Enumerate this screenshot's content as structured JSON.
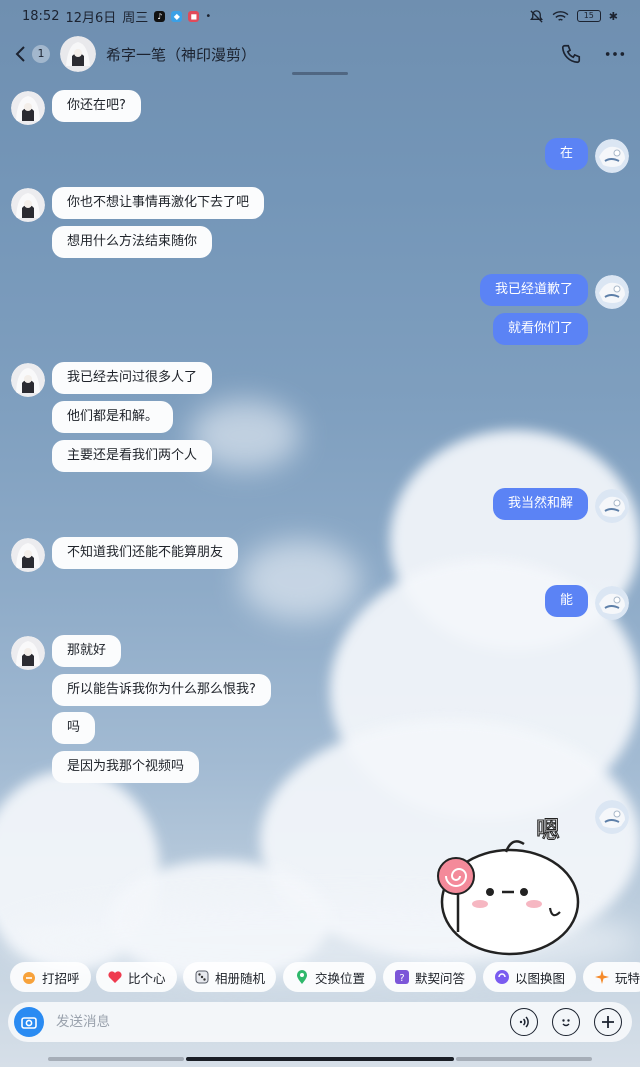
{
  "status_bar": {
    "time": "18:52",
    "date": "12月6日",
    "weekday": "周三",
    "battery": "15"
  },
  "header": {
    "unread_count": "1",
    "contact_name": "希字一笔（神印漫剪）"
  },
  "messages": [
    {
      "side": "in",
      "text": "你还在吧?"
    },
    {
      "side": "out",
      "text": "在"
    },
    {
      "side": "in",
      "text": "你也不想让事情再激化下去了吧"
    },
    {
      "side": "in",
      "text": "想用什么方法结束随你"
    },
    {
      "side": "out",
      "text": "我已经道歉了"
    },
    {
      "side": "out",
      "text": "就看你们了"
    },
    {
      "side": "in",
      "text": "我已经去问过很多人了"
    },
    {
      "side": "in",
      "text": "他们都是和解。"
    },
    {
      "side": "in",
      "text": "主要还是看我们两个人"
    },
    {
      "side": "out",
      "text": "我当然和解"
    },
    {
      "side": "in",
      "text": "不知道我们还能不能算朋友"
    },
    {
      "side": "out",
      "text": "能"
    },
    {
      "side": "in",
      "text": "那就好"
    },
    {
      "side": "in",
      "text": "所以能告诉我你为什么那么恨我?"
    },
    {
      "side": "in",
      "text": "吗"
    },
    {
      "side": "in",
      "text": "是因为我那个视频吗"
    }
  ],
  "sticker": {
    "text": "嗯"
  },
  "quick_actions": [
    {
      "label": "打招呼",
      "icon": "wave-icon"
    },
    {
      "label": "比个心",
      "icon": "heart-icon"
    },
    {
      "label": "相册随机",
      "icon": "dice-icon"
    },
    {
      "label": "交换位置",
      "icon": "location-pin-icon"
    },
    {
      "label": "默契问答",
      "icon": "question-icon"
    },
    {
      "label": "以图换图",
      "icon": "image-swap-icon"
    },
    {
      "label": "玩特",
      "icon": "sparkle-icon"
    }
  ],
  "input": {
    "placeholder": "发送消息"
  },
  "colors": {
    "outgoing_bubble": "#5b83f5",
    "incoming_bubble": "#fbfcfd",
    "camera_button": "#2a8bf2"
  }
}
